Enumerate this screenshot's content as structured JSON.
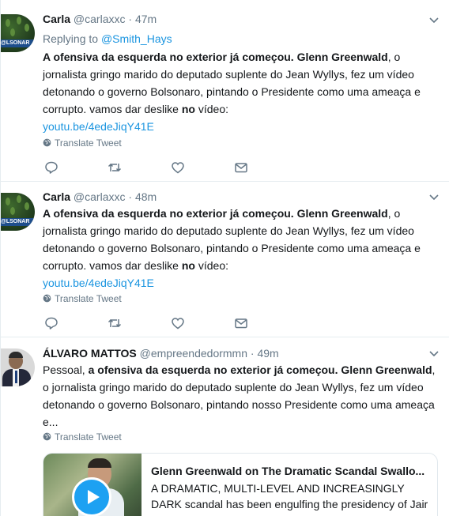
{
  "tweets": [
    {
      "name": "Carla",
      "handle": "@carlaxxc",
      "dot": "·",
      "time": "47m",
      "reply_prefix": "Replying to ",
      "reply_to": "@Smith_Hays",
      "avatar_text": "@LSONAR",
      "text_bold_1": "A ofensiva da esquerda no exterior já começou. Glenn Greenwald",
      "text_1": ", o jornalista gringo marido do deputado suplente do Jean Wyllys, fez um vídeo detonando o governo Bolsonaro, pintando o Presidente como uma ameaça e corrupto. vamos dar deslike ",
      "text_bold_2": "no",
      "text_2": " vídeo:",
      "link": "youtu.be/4edeJiqY41E",
      "translate": "Translate Tweet"
    },
    {
      "name": "Carla",
      "handle": "@carlaxxc",
      "dot": "·",
      "time": "48m",
      "avatar_text": "@LSONAR",
      "text_bold_1": "A ofensiva da esquerda no exterior já começou. Glenn Greenwald",
      "text_1": ", o jornalista gringo marido do deputado suplente do Jean Wyllys, fez um vídeo detonando o governo Bolsonaro, pintando o Presidente como uma ameaça e corrupto. vamos dar deslike ",
      "text_bold_2": "no",
      "text_2": " vídeo:",
      "link": "youtu.be/4edeJiqY41E",
      "translate": "Translate Tweet"
    },
    {
      "name": "ÁLVARO MATTOS",
      "handle": "@empreendedormmn",
      "dot": "·",
      "time": "49m",
      "text_1": "Pessoal, ",
      "text_bold_1": "a ofensiva da esquerda no exterior já começou. Glenn Greenwald",
      "text_2": ", o jornalista gringo marido do deputado suplente do Jean Wyllys, fez um vídeo detonando o governo Bolsonaro, pintando nosso Presidente como uma ameaça e...",
      "translate": "Translate Tweet",
      "card": {
        "title": "Glenn Greenwald on The Dramatic Scandal Swallo...",
        "description": "A DRAMATIC, MULTI-LEVEL AND INCREASINGLY DARK scandal has been engulfing the presidency of Jair"
      }
    }
  ],
  "icons": [
    "chevron-down-icon",
    "globe-icon",
    "reply-icon",
    "retweet-icon",
    "like-icon",
    "direct-message-icon",
    "play-icon"
  ],
  "colors": {
    "link": "#1b95e0",
    "muted": "#657786",
    "border": "#e6ecf0",
    "play": "#1da1f2"
  }
}
